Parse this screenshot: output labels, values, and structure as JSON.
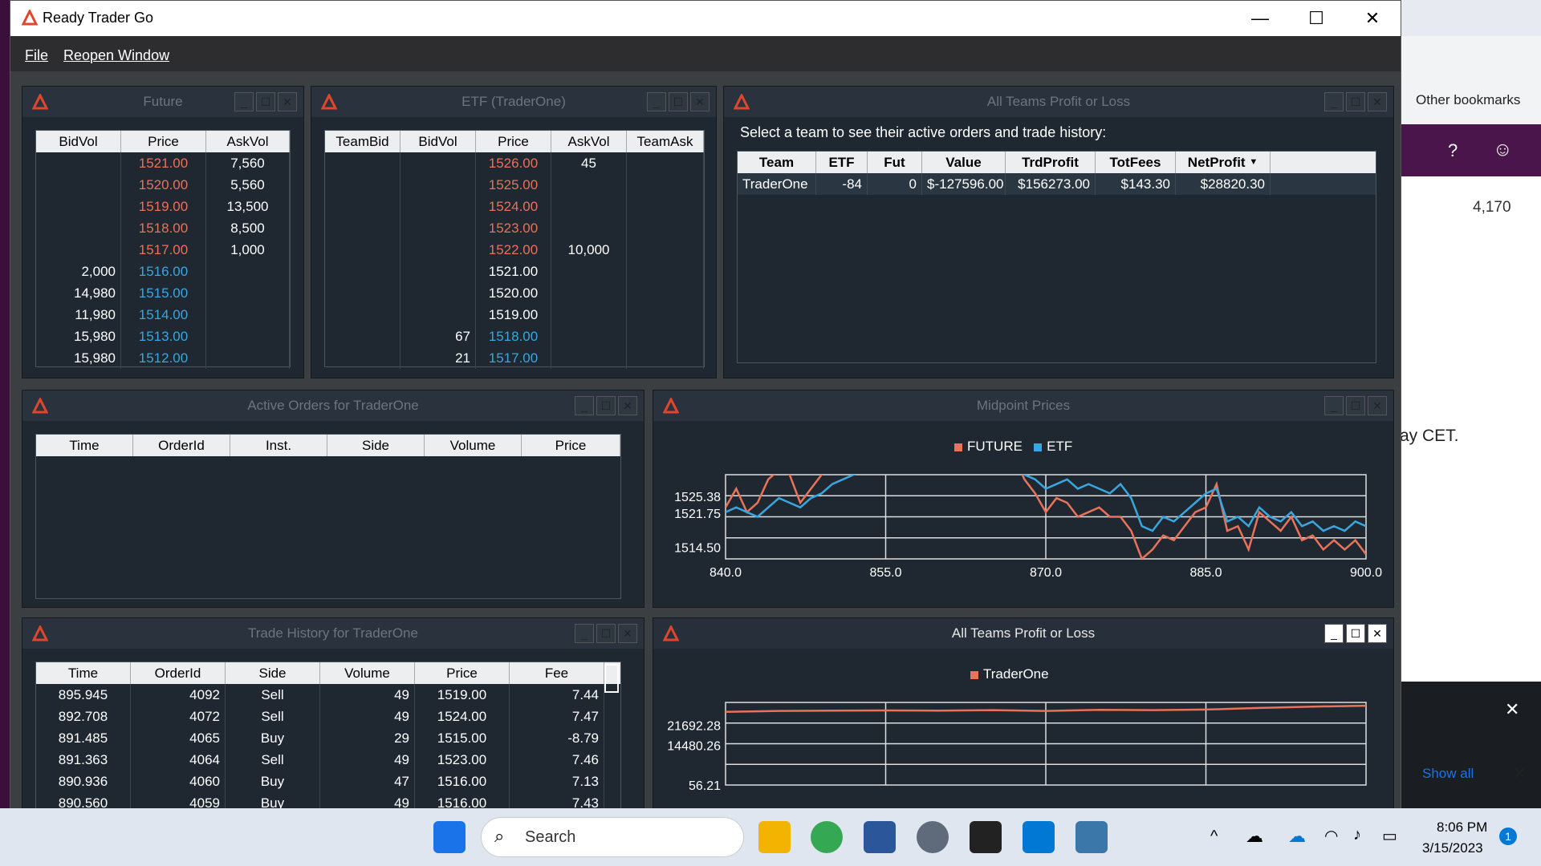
{
  "window": {
    "title": "Ready Trader Go",
    "minimize": "—",
    "maximize": "☐",
    "close": "✕"
  },
  "menu": {
    "file": "File",
    "reopen": "Reopen Window"
  },
  "future": {
    "title": "Future",
    "headers": [
      "BidVol",
      "Price",
      "AskVol"
    ],
    "rows": [
      [
        "",
        "1521.00",
        "7,560",
        "ask"
      ],
      [
        "",
        "1520.00",
        "5,560",
        "ask"
      ],
      [
        "",
        "1519.00",
        "13,500",
        "ask"
      ],
      [
        "",
        "1518.00",
        "8,500",
        "ask"
      ],
      [
        "",
        "1517.00",
        "1,000",
        "ask"
      ],
      [
        "2,000",
        "1516.00",
        "",
        "bid"
      ],
      [
        "14,980",
        "1515.00",
        "",
        "bid"
      ],
      [
        "11,980",
        "1514.00",
        "",
        "bid"
      ],
      [
        "15,980",
        "1513.00",
        "",
        "bid"
      ],
      [
        "15,980",
        "1512.00",
        "",
        "bid"
      ]
    ]
  },
  "etf": {
    "title": "ETF (TraderOne)",
    "headers": [
      "TeamBid",
      "BidVol",
      "Price",
      "AskVol",
      "TeamAsk"
    ],
    "rows": [
      [
        "",
        "",
        "1526.00",
        "45",
        "",
        "ask"
      ],
      [
        "",
        "",
        "1525.00",
        "",
        "",
        "ask"
      ],
      [
        "",
        "",
        "1524.00",
        "",
        "",
        "ask"
      ],
      [
        "",
        "",
        "1523.00",
        "",
        "",
        "ask"
      ],
      [
        "",
        "",
        "1522.00",
        "10,000",
        "",
        "ask"
      ],
      [
        "",
        "",
        "1521.00",
        "",
        "",
        "mid"
      ],
      [
        "",
        "",
        "1520.00",
        "",
        "",
        "mid"
      ],
      [
        "",
        "",
        "1519.00",
        "",
        "",
        "mid"
      ],
      [
        "",
        "67",
        "1518.00",
        "",
        "",
        "bid"
      ],
      [
        "",
        "21",
        "1517.00",
        "",
        "",
        "bid"
      ]
    ]
  },
  "pnl_table": {
    "title": "All Teams Profit or Loss",
    "caption": "Select a team to see their active orders and trade history:",
    "headers": [
      "Team",
      "ETF",
      "Fut",
      "Value",
      "TrdProfit",
      "TotFees",
      "NetProfit"
    ],
    "sort_icon": "▼",
    "rows": [
      [
        "TraderOne",
        "-84",
        "0",
        "$-127596.00",
        "$156273.00",
        "$143.30",
        "$28820.30"
      ]
    ]
  },
  "active_orders": {
    "title": "Active Orders for TraderOne",
    "headers": [
      "Time",
      "OrderId",
      "Inst.",
      "Side",
      "Volume",
      "Price"
    ]
  },
  "midpoint": {
    "title": "Midpoint Prices",
    "legend": [
      {
        "name": "FUTURE",
        "color": "#e8725a"
      },
      {
        "name": "ETF",
        "color": "#3aa6e0"
      }
    ]
  },
  "trade_history": {
    "title": "Trade History for TraderOne",
    "headers": [
      "Time",
      "OrderId",
      "Side",
      "Volume",
      "Price",
      "Fee"
    ],
    "rows": [
      [
        "895.945",
        "4092",
        "Sell",
        "49",
        "1519.00",
        "7.44"
      ],
      [
        "892.708",
        "4072",
        "Sell",
        "49",
        "1524.00",
        "7.47"
      ],
      [
        "891.485",
        "4065",
        "Buy",
        "29",
        "1515.00",
        "-8.79"
      ],
      [
        "891.363",
        "4064",
        "Sell",
        "49",
        "1523.00",
        "7.46"
      ],
      [
        "890.936",
        "4060",
        "Buy",
        "47",
        "1516.00",
        "7.13"
      ],
      [
        "890.560",
        "4059",
        "Buy",
        "49",
        "1516.00",
        "7.43"
      ]
    ]
  },
  "pnl_chart": {
    "title": "All Teams Profit or Loss",
    "legend": [
      {
        "name": "TraderOne",
        "color": "#e8725a"
      }
    ]
  },
  "chart_data": [
    {
      "type": "line",
      "title": "Midpoint Prices",
      "xlim": [
        840.0,
        900.0
      ],
      "xticks": [
        "840.0",
        "855.0",
        "870.0",
        "885.0",
        "900.0"
      ],
      "yticks": [
        "1514.50",
        "1521.75",
        "1525.38"
      ],
      "series": [
        {
          "name": "FUTURE",
          "color": "#e8725a",
          "x": [
            840,
            841,
            842,
            843,
            844,
            845,
            846,
            847,
            848,
            849,
            850,
            851,
            852,
            853,
            854,
            866,
            867,
            868,
            869,
            870,
            871,
            872,
            873,
            874,
            875,
            876,
            877,
            878,
            879,
            880,
            881,
            882,
            883,
            884,
            885,
            886,
            887,
            888,
            889,
            890,
            891,
            892,
            893,
            894,
            895,
            896,
            897,
            898,
            899,
            900
          ],
          "y": [
            1523,
            1527,
            1522,
            1524,
            1529,
            1531,
            1530,
            1524,
            1527,
            1530,
            1533,
            1534,
            1535,
            1536,
            1537,
            1532,
            1534,
            1529,
            1526,
            1522,
            1525,
            1524,
            1521,
            1522,
            1523,
            1521,
            1521,
            1518,
            1512,
            1514,
            1517,
            1516,
            1519,
            1522,
            1523,
            1528,
            1518,
            1519,
            1514,
            1522,
            1520,
            1518,
            1521,
            1516,
            1517,
            1514,
            1516,
            1514,
            1516,
            1513
          ]
        },
        {
          "name": "ETF",
          "color": "#3aa6e0",
          "x": [
            840,
            841,
            842,
            843,
            844,
            845,
            846,
            847,
            848,
            849,
            850,
            851,
            852,
            853,
            854,
            866,
            867,
            868,
            869,
            870,
            871,
            872,
            873,
            874,
            875,
            876,
            877,
            878,
            879,
            880,
            881,
            882,
            883,
            884,
            885,
            886,
            887,
            888,
            889,
            890,
            891,
            892,
            893,
            894,
            895,
            896,
            897,
            898,
            899,
            900
          ],
          "y": [
            1522,
            1523,
            1522,
            1521,
            1523,
            1525,
            1524,
            1523,
            1525,
            1526,
            1528,
            1529,
            1530,
            1531,
            1532,
            1533,
            1531,
            1530,
            1529,
            1527,
            1528,
            1529,
            1527,
            1528,
            1527,
            1526,
            1528,
            1525,
            1519,
            1518,
            1521,
            1520,
            1522,
            1524,
            1526,
            1527,
            1520,
            1521,
            1519,
            1523,
            1521,
            1520,
            1522,
            1519,
            1520,
            1518,
            1519,
            1518,
            1520,
            1519
          ]
        }
      ]
    },
    {
      "type": "line",
      "title": "All Teams Profit or Loss",
      "xlim": [
        840.0,
        900.0
      ],
      "yticks": [
        "56.21",
        "14480.26",
        "21692.28"
      ],
      "series": [
        {
          "name": "TraderOne",
          "color": "#e8725a",
          "x": [
            840,
            845,
            850,
            855,
            860,
            865,
            870,
            875,
            880,
            885,
            890,
            895,
            900
          ],
          "y": [
            26600,
            26900,
            27000,
            27100,
            27000,
            27200,
            26900,
            27300,
            27200,
            27400,
            28000,
            28500,
            28820
          ]
        }
      ]
    }
  ],
  "taskbar": {
    "search": "Search",
    "time": "8:06 PM",
    "date": "3/15/2023",
    "notif_count": "1"
  },
  "browser_bg": {
    "other_bookmarks": "Other bookmarks",
    "count": "4,170",
    "cet": "ay CET.",
    "show_all": "Show all"
  }
}
